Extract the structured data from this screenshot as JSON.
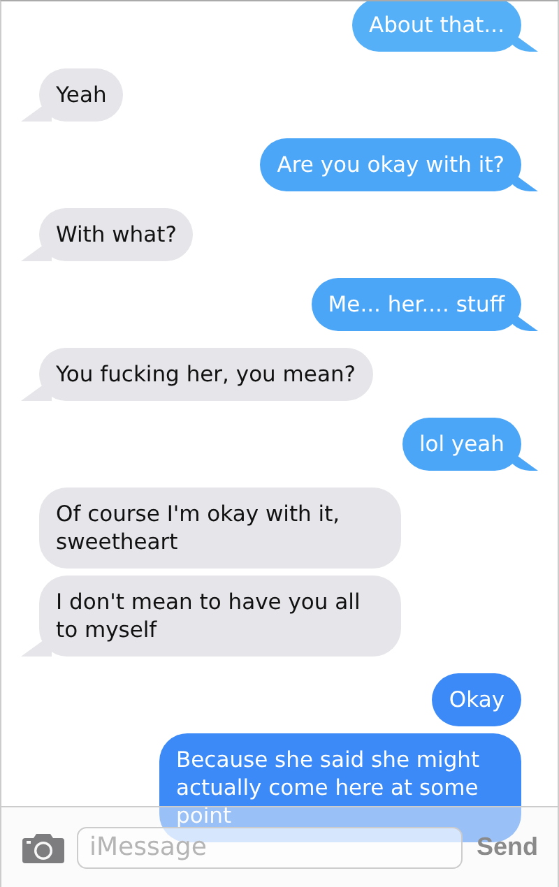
{
  "messages": [
    {
      "kind": "sent",
      "text": "About that...",
      "color": "#56b0f8",
      "tail": true
    },
    {
      "kind": "received",
      "text": "Yeah",
      "color": "#e5e5ea",
      "tail": true
    },
    {
      "kind": "sent",
      "text": "Are you okay with it?",
      "color": "#4ba6f8",
      "tail": true
    },
    {
      "kind": "received",
      "text": "With what?",
      "color": "#e5e5ea",
      "tail": true
    },
    {
      "kind": "sent",
      "text": "Me... her.... stuff",
      "color": "#4ba6f8",
      "tail": true
    },
    {
      "kind": "received",
      "text": "You fucking her, you mean?",
      "color": "#e5e5ea",
      "tail": true
    },
    {
      "kind": "sent",
      "text": "lol yeah",
      "color": "#4ba6f8",
      "tail": true
    },
    {
      "kind": "received",
      "text": "Of course I'm okay with it, sweetheart",
      "color": "#e5e5ea",
      "tail": false
    },
    {
      "kind": "received",
      "text": "I don't mean to have you all to myself",
      "color": "#e5e5ea",
      "tail": true
    },
    {
      "kind": "sent",
      "text": "Okay",
      "color": "#3b8af7",
      "tail": false
    },
    {
      "kind": "sent",
      "text": "Because she said she might actually come here at some point",
      "color": "#3b8af7",
      "tail": false
    }
  ],
  "composer": {
    "placeholder": "iMessage",
    "send": "Send"
  }
}
